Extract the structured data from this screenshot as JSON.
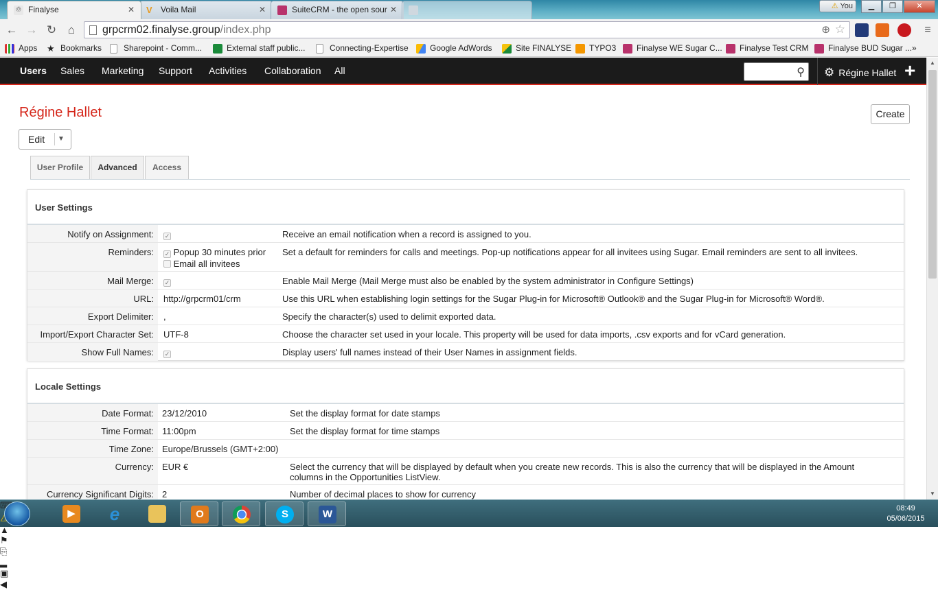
{
  "browser": {
    "tabs": [
      {
        "title": "Finalyse",
        "active": true
      },
      {
        "title": "Voila Mail",
        "active": false
      },
      {
        "title": "SuiteCRM - the open sour",
        "active": false
      },
      {
        "title": "",
        "active": false
      }
    ],
    "profile_label": "You",
    "url_host": "grpcrm02.finalyse.group",
    "url_path": "/index.php",
    "bookmarks": [
      "Apps",
      "Bookmarks",
      "Sharepoint - Comm...",
      "External staff public...",
      "Connecting-Expertise",
      "Google AdWords",
      "Site FINALYSE",
      "TYPO3",
      "Finalyse WE Sugar C...",
      "Finalyse Test CRM",
      "Finalyse BUD Sugar ..."
    ],
    "bookmarks_more": "»"
  },
  "crm_nav": {
    "items": [
      "Users",
      "Sales",
      "Marketing",
      "Support",
      "Activities",
      "Collaboration",
      "All"
    ],
    "user_name": "Régine Hallet"
  },
  "page": {
    "title": "Régine Hallet",
    "create_label": "Create",
    "edit_label": "Edit",
    "tabs": [
      "User Profile",
      "Advanced",
      "Access"
    ]
  },
  "user_settings": {
    "heading": "User Settings",
    "rows": [
      {
        "label": "Notify on Assignment:",
        "value": "",
        "checked": true,
        "desc": "Receive an email notification when a record is assigned to you."
      },
      {
        "label": "Reminders:",
        "popup_label": "Popup 30 minutes prior",
        "email_label": "Email all invitees",
        "desc": "Set a default for reminders for calls and meetings. Pop-up notifications appear for all invitees using Sugar. Email reminders are sent to all invitees."
      },
      {
        "label": "Mail Merge:",
        "value": "",
        "checked": true,
        "desc": "Enable Mail Merge (Mail Merge must also be enabled by the system administrator in Configure Settings)"
      },
      {
        "label": "URL:",
        "value": "http://grpcrm01/crm",
        "desc": "Use this URL when establishing login settings for the Sugar Plug-in for Microsoft® Outlook® and the Sugar Plug-in for Microsoft® Word®."
      },
      {
        "label": "Export Delimiter:",
        "value": ",",
        "desc": "Specify the character(s) used to delimit exported data."
      },
      {
        "label": "Import/Export Character Set:",
        "value": "UTF-8",
        "desc": "Choose the character set used in your locale. This property will be used for data imports, .csv exports and for vCard generation."
      },
      {
        "label": "Show Full Names:",
        "value": "",
        "checked": true,
        "desc": "Display users' full names instead of their User Names in assignment fields."
      }
    ]
  },
  "locale_settings": {
    "heading": "Locale Settings",
    "rows": [
      {
        "label": "Date Format:",
        "value": "23/12/2010",
        "desc": "Set the display format for date stamps"
      },
      {
        "label": "Time Format:",
        "value": "11:00pm",
        "desc": "Set the display format for time stamps"
      },
      {
        "label": "Time Zone:",
        "value": "Europe/Brussels (GMT+2:00)",
        "desc": ""
      },
      {
        "label": "Currency:",
        "value": "EUR €",
        "desc_line1": "Select the currency that will be displayed by default when you create new records. This is also the currency that will be displayed in the Amount",
        "desc_line2": "columns in the Opportunities ListView."
      },
      {
        "label": "Currency Significant Digits:",
        "value": "2",
        "desc": "Number of decimal places to show for currency"
      }
    ]
  },
  "taskbar": {
    "time": "08:49",
    "date": "05/06/2015"
  },
  "colors": {
    "brand_red": "#d5261a",
    "nav_dark": "#1b1b1b"
  }
}
